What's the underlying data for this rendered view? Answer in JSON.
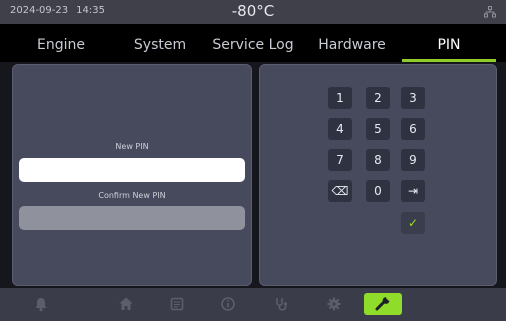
{
  "status": {
    "date": "2024-09-23",
    "time": "14:35",
    "temperature": "-80°C"
  },
  "tabs": [
    {
      "label": "Engine"
    },
    {
      "label": "System"
    },
    {
      "label": "Service Log"
    },
    {
      "label": "Hardware"
    },
    {
      "label": "PIN",
      "active": true
    }
  ],
  "pin_form": {
    "new_pin_label": "New PIN",
    "new_pin_value": "",
    "confirm_pin_label": "Confirm New PIN",
    "confirm_pin_value": ""
  },
  "keypad": {
    "k1": "1",
    "k2": "2",
    "k3": "3",
    "k4": "4",
    "k5": "5",
    "k6": "6",
    "k7": "7",
    "k8": "8",
    "k9": "9",
    "k0": "0",
    "backspace": "⌫",
    "next": "⇥",
    "confirm": "✓"
  },
  "bottom_nav": {
    "items": [
      "bell-icon",
      "home-icon",
      "document-icon",
      "info-icon",
      "stethoscope-icon",
      "gear-icon",
      "wrench-icon"
    ],
    "active": "wrench-icon"
  },
  "colors": {
    "accent": "#8fdc2a",
    "panel": "#474a5c",
    "tab_indicator": "#8fcd2c"
  }
}
